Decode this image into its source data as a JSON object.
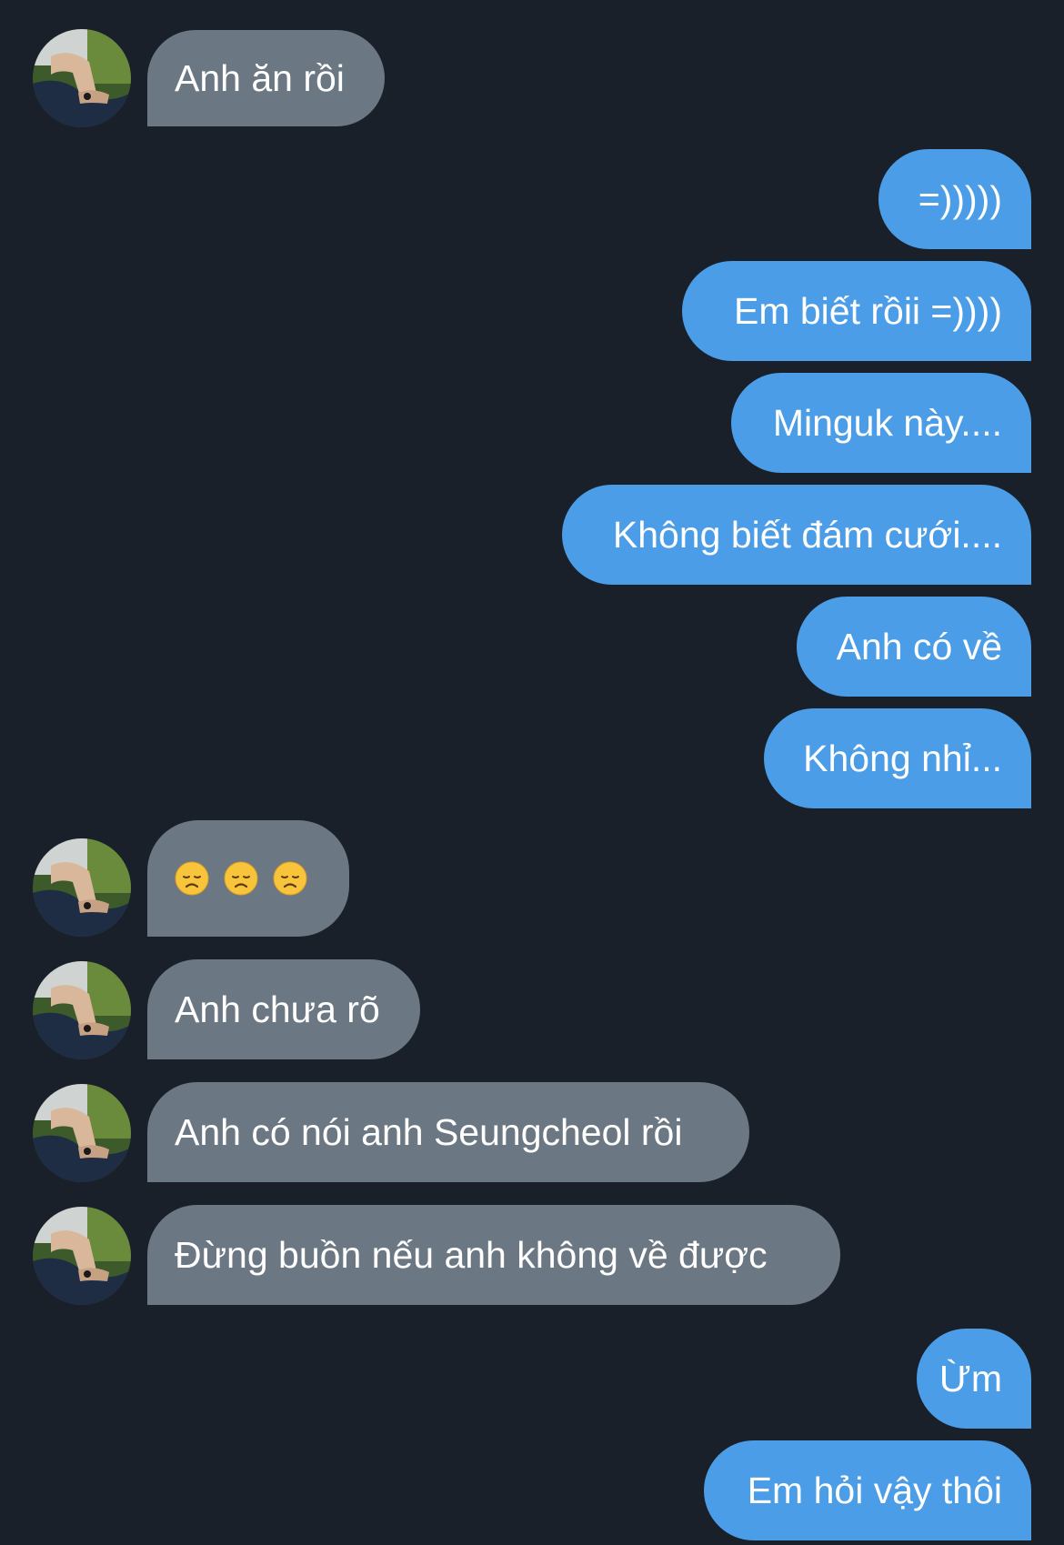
{
  "messages": [
    {
      "side": "received",
      "text": "Anh ăn rồi"
    },
    {
      "side": "sent",
      "text": "=)))))"
    },
    {
      "side": "sent",
      "text": "Em biết rồii =))))"
    },
    {
      "side": "sent",
      "text": "Minguk này...."
    },
    {
      "side": "sent",
      "text": "Không biết đám cưới...."
    },
    {
      "side": "sent",
      "text": "Anh có về"
    },
    {
      "side": "sent",
      "text": "Không nhỉ..."
    },
    {
      "side": "received",
      "emoji": [
        "disappointed-face",
        "disappointed-face",
        "disappointed-face"
      ]
    },
    {
      "side": "received",
      "text": "Anh chưa rõ"
    },
    {
      "side": "received",
      "text": "Anh có nói anh Seungcheol rồi"
    },
    {
      "side": "received",
      "text": "Đừng buồn nếu anh không về được"
    },
    {
      "side": "sent",
      "text": "Ừm"
    },
    {
      "side": "sent",
      "text": "Em hỏi vậy thôi"
    }
  ],
  "colors": {
    "background": "#19202a",
    "received_bubble": "#6b7782",
    "sent_bubble": "#4a9de6",
    "text": "#ffffff"
  }
}
